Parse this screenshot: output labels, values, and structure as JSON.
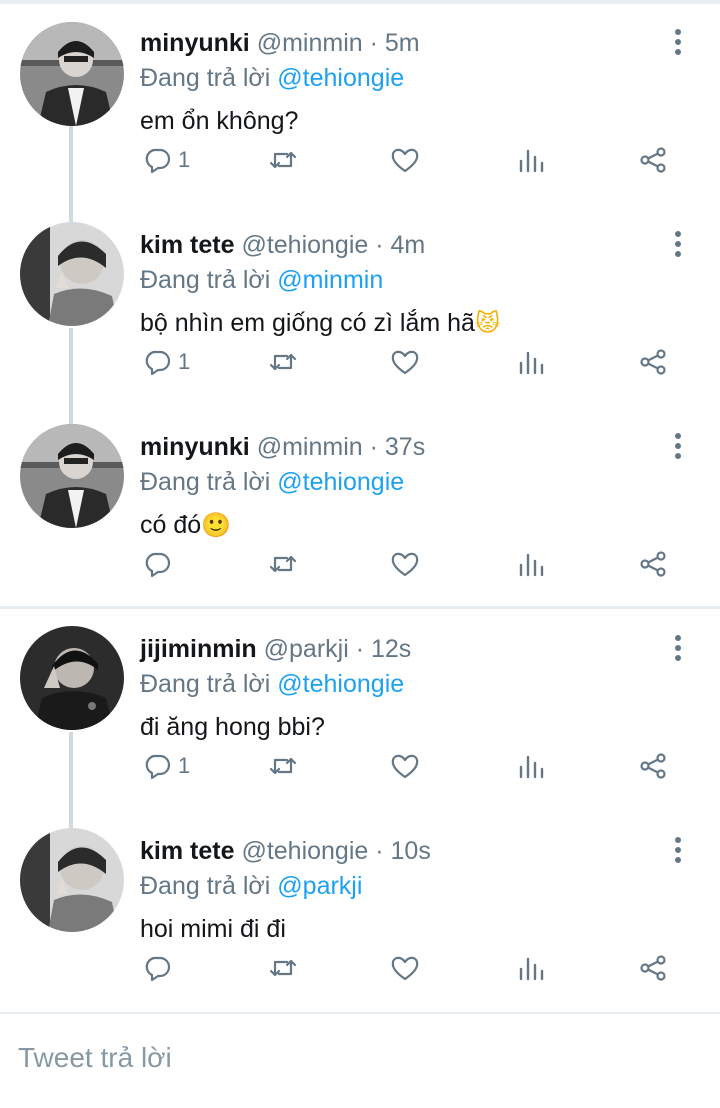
{
  "tweets": [
    {
      "name": "minyunki",
      "handle": "@minmin",
      "separator": "·",
      "time": "5m",
      "reply_prefix": "Đang trả lời",
      "reply_mention": "@tehiongie",
      "text": "em ổn không?",
      "emoji": "",
      "reply_count": "1",
      "avatar": "minyunki-avatar"
    },
    {
      "name": "kim tete",
      "handle": "@tehiongie",
      "separator": "·",
      "time": "4m",
      "reply_prefix": "Đang trả lời",
      "reply_mention": "@minmin",
      "text": "bộ nhìn em giống có zì lắm hã",
      "emoji": "😾",
      "reply_count": "1",
      "avatar": "kim-tete-avatar"
    },
    {
      "name": "minyunki",
      "handle": "@minmin",
      "separator": "·",
      "time": "37s",
      "reply_prefix": "Đang trả lời",
      "reply_mention": "@tehiongie",
      "text": "có đó",
      "emoji": "🙂",
      "reply_count": "",
      "avatar": "minyunki-avatar"
    },
    {
      "name": "jijiminmin",
      "handle": "@parkji",
      "separator": "·",
      "time": "12s",
      "reply_prefix": "Đang trả lời",
      "reply_mention": "@tehiongie",
      "text": "đi ăng hong bbi?",
      "emoji": "",
      "reply_count": "1",
      "avatar": "jijiminmin-avatar"
    },
    {
      "name": "kim tete",
      "handle": "@tehiongie",
      "separator": "·",
      "time": "10s",
      "reply_prefix": "Đang trả lời",
      "reply_mention": "@parkji",
      "text": "hoi mimi đi đi",
      "emoji": "",
      "reply_count": "",
      "avatar": "kim-tete-avatar"
    }
  ],
  "icons": {
    "reply": "reply-icon",
    "retweet": "retweet-icon",
    "like": "heart-icon",
    "stats": "stats-icon",
    "share": "share-icon",
    "more": "more-vertical-icon"
  },
  "compose": {
    "placeholder": "Tweet trả lời"
  },
  "colors": {
    "mention": "#1da1f2",
    "secondary_text": "#657786",
    "thread_line": "#cfd9de"
  }
}
